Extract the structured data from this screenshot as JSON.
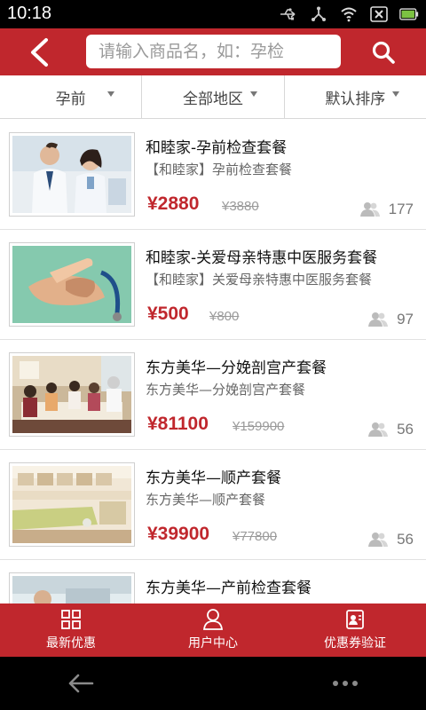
{
  "status_bar": {
    "time": "10:18"
  },
  "header": {
    "search_placeholder": "请输入商品名，如：孕检"
  },
  "filters": [
    {
      "label": "孕前"
    },
    {
      "label": "全部地区"
    },
    {
      "label": "默认排序"
    }
  ],
  "products": [
    {
      "title": "和睦家-孕前检查套餐",
      "subtitle": "【和睦家】孕前检查套餐",
      "price": "¥2880",
      "original_price": "¥3880",
      "count": "177"
    },
    {
      "title": "和睦家-关爱母亲特惠中医服务套餐",
      "subtitle": "【和睦家】关爱母亲特惠中医服务套餐",
      "price": "¥500",
      "original_price": "¥800",
      "count": "97"
    },
    {
      "title": "东方美华—分娩剖宫产套餐",
      "subtitle": "东方美华—分娩剖宫产套餐",
      "price": "¥81100",
      "original_price": "¥159900",
      "count": "56"
    },
    {
      "title": "东方美华—顺产套餐",
      "subtitle": "东方美华—顺产套餐",
      "price": "¥39900",
      "original_price": "¥77800",
      "count": "56"
    },
    {
      "title": "东方美华—产前检查套餐",
      "subtitle": "",
      "price": "",
      "original_price": "",
      "count": ""
    }
  ],
  "bottom_nav": [
    {
      "label": "最新优惠",
      "icon": "grid-icon"
    },
    {
      "label": "用户中心",
      "icon": "user-icon"
    },
    {
      "label": "优惠券验证",
      "icon": "coupon-card-icon"
    }
  ],
  "colors": {
    "brand_red": "#c0272d",
    "status_bar": "#000000"
  }
}
